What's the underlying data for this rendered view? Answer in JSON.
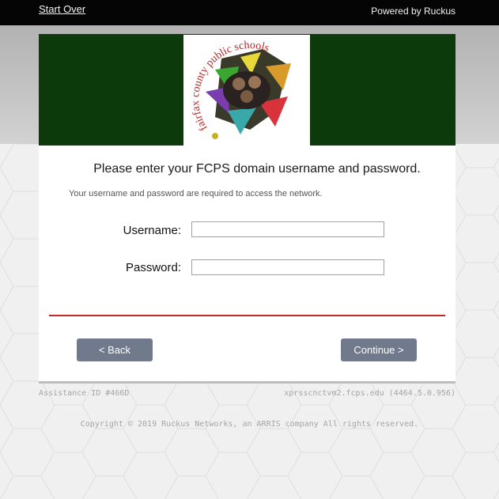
{
  "topbar": {
    "start_over": "Start Over",
    "powered_by": "Powered by Ruckus"
  },
  "header": {
    "logo_text": "fairfax county public schools"
  },
  "form": {
    "headline": "Please enter your FCPS domain username and password.",
    "subtext": "Your username and password are required to access the network.",
    "username_label": "Username:",
    "password_label": "Password:",
    "username_value": "",
    "password_value": "",
    "back_label": "< Back",
    "continue_label": "Continue >"
  },
  "footer": {
    "assistance_id": "Assistance ID #466D",
    "server": "xprsscnctvm2.fcps.edu (4464.5.0.956)",
    "copyright": "Copyright © 2019 Ruckus Networks, an ARRIS company All rights reserved."
  },
  "colors": {
    "header_green": "#0c3a0a",
    "divider_red": "#c02a2a",
    "button": "#707a8c"
  }
}
